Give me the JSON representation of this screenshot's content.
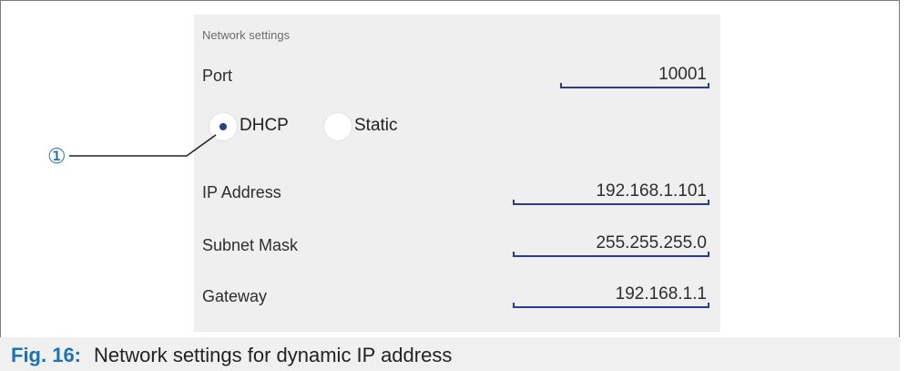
{
  "figure": {
    "label": "Fig. 16:",
    "caption": "Network settings for dynamic IP address",
    "callout": "①"
  },
  "settings": {
    "section_title": "Network settings",
    "port": {
      "label": "Port",
      "value": "10001"
    },
    "mode": {
      "options": [
        {
          "label": "DHCP",
          "selected": true
        },
        {
          "label": "Static",
          "selected": false
        }
      ]
    },
    "ip_address": {
      "label": "IP Address",
      "value": "192.168.1.101"
    },
    "subnet_mask": {
      "label": "Subnet Mask",
      "value": "255.255.255.0"
    },
    "gateway": {
      "label": "Gateway",
      "value": "192.168.1.1"
    }
  },
  "colors": {
    "accent": "#1a72b8",
    "field_underline": "#2c3a92",
    "panel_background": "#efefef"
  }
}
